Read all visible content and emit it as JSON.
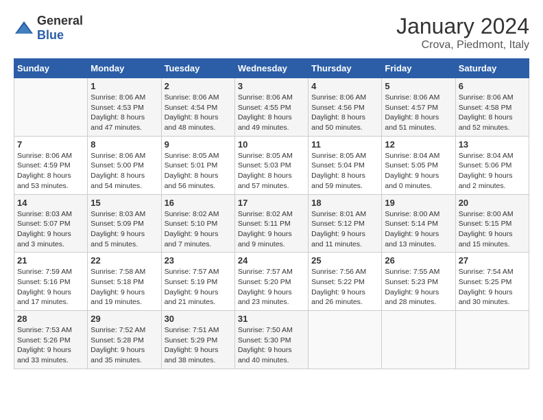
{
  "header": {
    "logo_general": "General",
    "logo_blue": "Blue",
    "title": "January 2024",
    "subtitle": "Crova, Piedmont, Italy"
  },
  "columns": [
    "Sunday",
    "Monday",
    "Tuesday",
    "Wednesday",
    "Thursday",
    "Friday",
    "Saturday"
  ],
  "weeks": [
    [
      {
        "day": "",
        "info": ""
      },
      {
        "day": "1",
        "info": "Sunrise: 8:06 AM\nSunset: 4:53 PM\nDaylight: 8 hours\nand 47 minutes."
      },
      {
        "day": "2",
        "info": "Sunrise: 8:06 AM\nSunset: 4:54 PM\nDaylight: 8 hours\nand 48 minutes."
      },
      {
        "day": "3",
        "info": "Sunrise: 8:06 AM\nSunset: 4:55 PM\nDaylight: 8 hours\nand 49 minutes."
      },
      {
        "day": "4",
        "info": "Sunrise: 8:06 AM\nSunset: 4:56 PM\nDaylight: 8 hours\nand 50 minutes."
      },
      {
        "day": "5",
        "info": "Sunrise: 8:06 AM\nSunset: 4:57 PM\nDaylight: 8 hours\nand 51 minutes."
      },
      {
        "day": "6",
        "info": "Sunrise: 8:06 AM\nSunset: 4:58 PM\nDaylight: 8 hours\nand 52 minutes."
      }
    ],
    [
      {
        "day": "7",
        "info": "Sunrise: 8:06 AM\nSunset: 4:59 PM\nDaylight: 8 hours\nand 53 minutes."
      },
      {
        "day": "8",
        "info": "Sunrise: 8:06 AM\nSunset: 5:00 PM\nDaylight: 8 hours\nand 54 minutes."
      },
      {
        "day": "9",
        "info": "Sunrise: 8:05 AM\nSunset: 5:01 PM\nDaylight: 8 hours\nand 56 minutes."
      },
      {
        "day": "10",
        "info": "Sunrise: 8:05 AM\nSunset: 5:03 PM\nDaylight: 8 hours\nand 57 minutes."
      },
      {
        "day": "11",
        "info": "Sunrise: 8:05 AM\nSunset: 5:04 PM\nDaylight: 8 hours\nand 59 minutes."
      },
      {
        "day": "12",
        "info": "Sunrise: 8:04 AM\nSunset: 5:05 PM\nDaylight: 9 hours\nand 0 minutes."
      },
      {
        "day": "13",
        "info": "Sunrise: 8:04 AM\nSunset: 5:06 PM\nDaylight: 9 hours\nand 2 minutes."
      }
    ],
    [
      {
        "day": "14",
        "info": "Sunrise: 8:03 AM\nSunset: 5:07 PM\nDaylight: 9 hours\nand 3 minutes."
      },
      {
        "day": "15",
        "info": "Sunrise: 8:03 AM\nSunset: 5:09 PM\nDaylight: 9 hours\nand 5 minutes."
      },
      {
        "day": "16",
        "info": "Sunrise: 8:02 AM\nSunset: 5:10 PM\nDaylight: 9 hours\nand 7 minutes."
      },
      {
        "day": "17",
        "info": "Sunrise: 8:02 AM\nSunset: 5:11 PM\nDaylight: 9 hours\nand 9 minutes."
      },
      {
        "day": "18",
        "info": "Sunrise: 8:01 AM\nSunset: 5:12 PM\nDaylight: 9 hours\nand 11 minutes."
      },
      {
        "day": "19",
        "info": "Sunrise: 8:00 AM\nSunset: 5:14 PM\nDaylight: 9 hours\nand 13 minutes."
      },
      {
        "day": "20",
        "info": "Sunrise: 8:00 AM\nSunset: 5:15 PM\nDaylight: 9 hours\nand 15 minutes."
      }
    ],
    [
      {
        "day": "21",
        "info": "Sunrise: 7:59 AM\nSunset: 5:16 PM\nDaylight: 9 hours\nand 17 minutes."
      },
      {
        "day": "22",
        "info": "Sunrise: 7:58 AM\nSunset: 5:18 PM\nDaylight: 9 hours\nand 19 minutes."
      },
      {
        "day": "23",
        "info": "Sunrise: 7:57 AM\nSunset: 5:19 PM\nDaylight: 9 hours\nand 21 minutes."
      },
      {
        "day": "24",
        "info": "Sunrise: 7:57 AM\nSunset: 5:20 PM\nDaylight: 9 hours\nand 23 minutes."
      },
      {
        "day": "25",
        "info": "Sunrise: 7:56 AM\nSunset: 5:22 PM\nDaylight: 9 hours\nand 26 minutes."
      },
      {
        "day": "26",
        "info": "Sunrise: 7:55 AM\nSunset: 5:23 PM\nDaylight: 9 hours\nand 28 minutes."
      },
      {
        "day": "27",
        "info": "Sunrise: 7:54 AM\nSunset: 5:25 PM\nDaylight: 9 hours\nand 30 minutes."
      }
    ],
    [
      {
        "day": "28",
        "info": "Sunrise: 7:53 AM\nSunset: 5:26 PM\nDaylight: 9 hours\nand 33 minutes."
      },
      {
        "day": "29",
        "info": "Sunrise: 7:52 AM\nSunset: 5:28 PM\nDaylight: 9 hours\nand 35 minutes."
      },
      {
        "day": "30",
        "info": "Sunrise: 7:51 AM\nSunset: 5:29 PM\nDaylight: 9 hours\nand 38 minutes."
      },
      {
        "day": "31",
        "info": "Sunrise: 7:50 AM\nSunset: 5:30 PM\nDaylight: 9 hours\nand 40 minutes."
      },
      {
        "day": "",
        "info": ""
      },
      {
        "day": "",
        "info": ""
      },
      {
        "day": "",
        "info": ""
      }
    ]
  ]
}
